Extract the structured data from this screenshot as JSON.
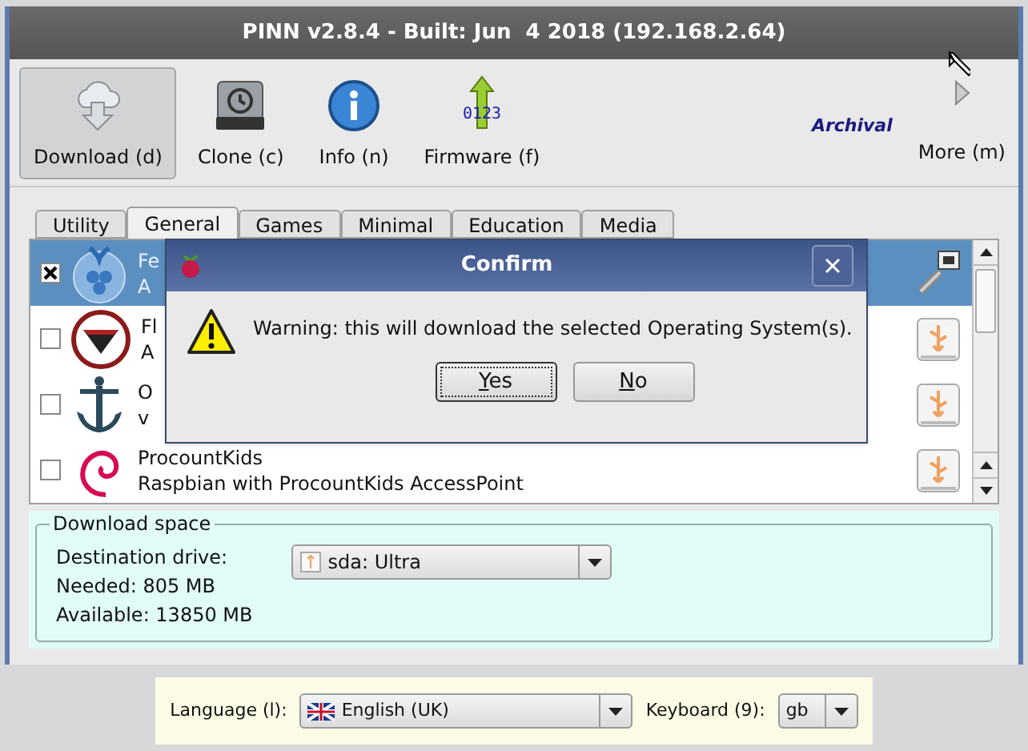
{
  "window": {
    "title": "PINN v2.8.4 - Built: Jun  4 2018 (192.168.2.64)"
  },
  "toolbar": [
    {
      "kind": "download",
      "label": "Download (d)",
      "selected": true
    },
    {
      "kind": "clone",
      "label": "Clone (c)",
      "selected": false
    },
    {
      "kind": "info",
      "label": "Info (n)",
      "selected": false
    },
    {
      "kind": "firmware",
      "label": "Firmware (f)",
      "badge": "0123",
      "selected": false
    }
  ],
  "archival": "Archival",
  "more": {
    "label": "More (m)"
  },
  "tabs": [
    {
      "label": "Utility",
      "selected": false
    },
    {
      "label": "General",
      "selected": true
    },
    {
      "label": "Games",
      "selected": false
    },
    {
      "label": "Minimal",
      "selected": false
    },
    {
      "label": "Education",
      "selected": false
    },
    {
      "label": "Media",
      "selected": false
    }
  ],
  "os_list": [
    {
      "name": "Fe",
      "description": "A",
      "checked": true,
      "selected": true,
      "kind": "network"
    },
    {
      "name": "Fl",
      "description": "A",
      "checked": false,
      "selected": false,
      "kind": "usb"
    },
    {
      "name": "O",
      "description": "v",
      "checked": false,
      "selected": false,
      "kind": "usb"
    },
    {
      "name": "ProcountKids",
      "description": "Raspbian with ProcountKids AccessPoint",
      "checked": false,
      "selected": false,
      "kind": "usb"
    }
  ],
  "dialog": {
    "title": "Confirm",
    "message": "Warning: this will download the selected Operating System(s).",
    "buttons": [
      {
        "label": "Yes",
        "focused": true
      },
      {
        "label": "No",
        "focused": false
      }
    ]
  },
  "download_space": {
    "title": "Download space",
    "destination_label": "Destination drive:",
    "drive": "sda: Ultra",
    "needed": "Needed: 805 MB",
    "available": "Available: 13850 MB"
  },
  "footer": {
    "language_label": "Language (l):",
    "language": "English (UK)",
    "keyboard_label": "Keyboard (9):",
    "keyboard": "gb"
  }
}
